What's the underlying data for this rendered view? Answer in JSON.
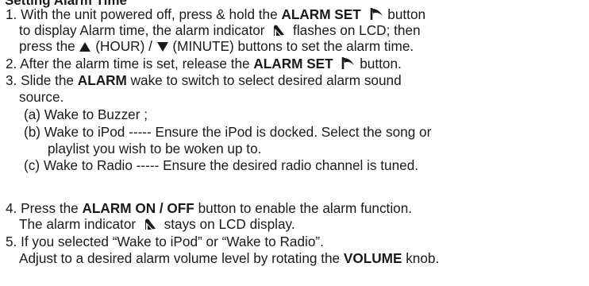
{
  "heading": "Setting Alarm Time",
  "steps": {
    "s1": {
      "a": "1. With the unit powered off, press & hold the ",
      "b": "ALARM SET",
      "c": " button",
      "d": "to display Alarm time, the alarm indicator ",
      "e": " flashes on LCD; then",
      "f": "press the ",
      "g": " (HOUR) / ",
      "h": " (MINUTE) buttons to set the alarm time."
    },
    "s2": {
      "a": "2. After the alarm time is set, release the ",
      "b": "ALARM SET",
      "c": " button."
    },
    "s3": {
      "a": "3. Slide the ",
      "b": "ALARM",
      "c": " wake to switch to select desired alarm sound",
      "d": "source.",
      "opt_a": "(a) Wake to Buzzer ;",
      "opt_b1": "(b) Wake to iPod ----- Ensure the iPod is docked. Select the song or",
      "opt_b2": "playlist you wish to be woken up to.",
      "opt_c": "(c) Wake to Radio ----- Ensure the desired radio channel is tuned."
    },
    "s4": {
      "a": "4. Press the ",
      "b": "ALARM ON / OFF",
      "c": " button to enable the alarm function.",
      "d": "The alarm indicator ",
      "e": " stays on LCD display."
    },
    "s5": {
      "a": "5. If you selected “Wake to iPod” or “Wake to Radio”.",
      "b": "Adjust to a desired alarm volume level by rotating the ",
      "c": "VOLUME",
      "d": " knob."
    }
  },
  "icons": {
    "alarm_set": "alarm-set-icon",
    "alarm_indicator": "alarm-indicator-icon",
    "up_arrow": "up-triangle-icon",
    "down_arrow": "down-triangle-icon"
  }
}
